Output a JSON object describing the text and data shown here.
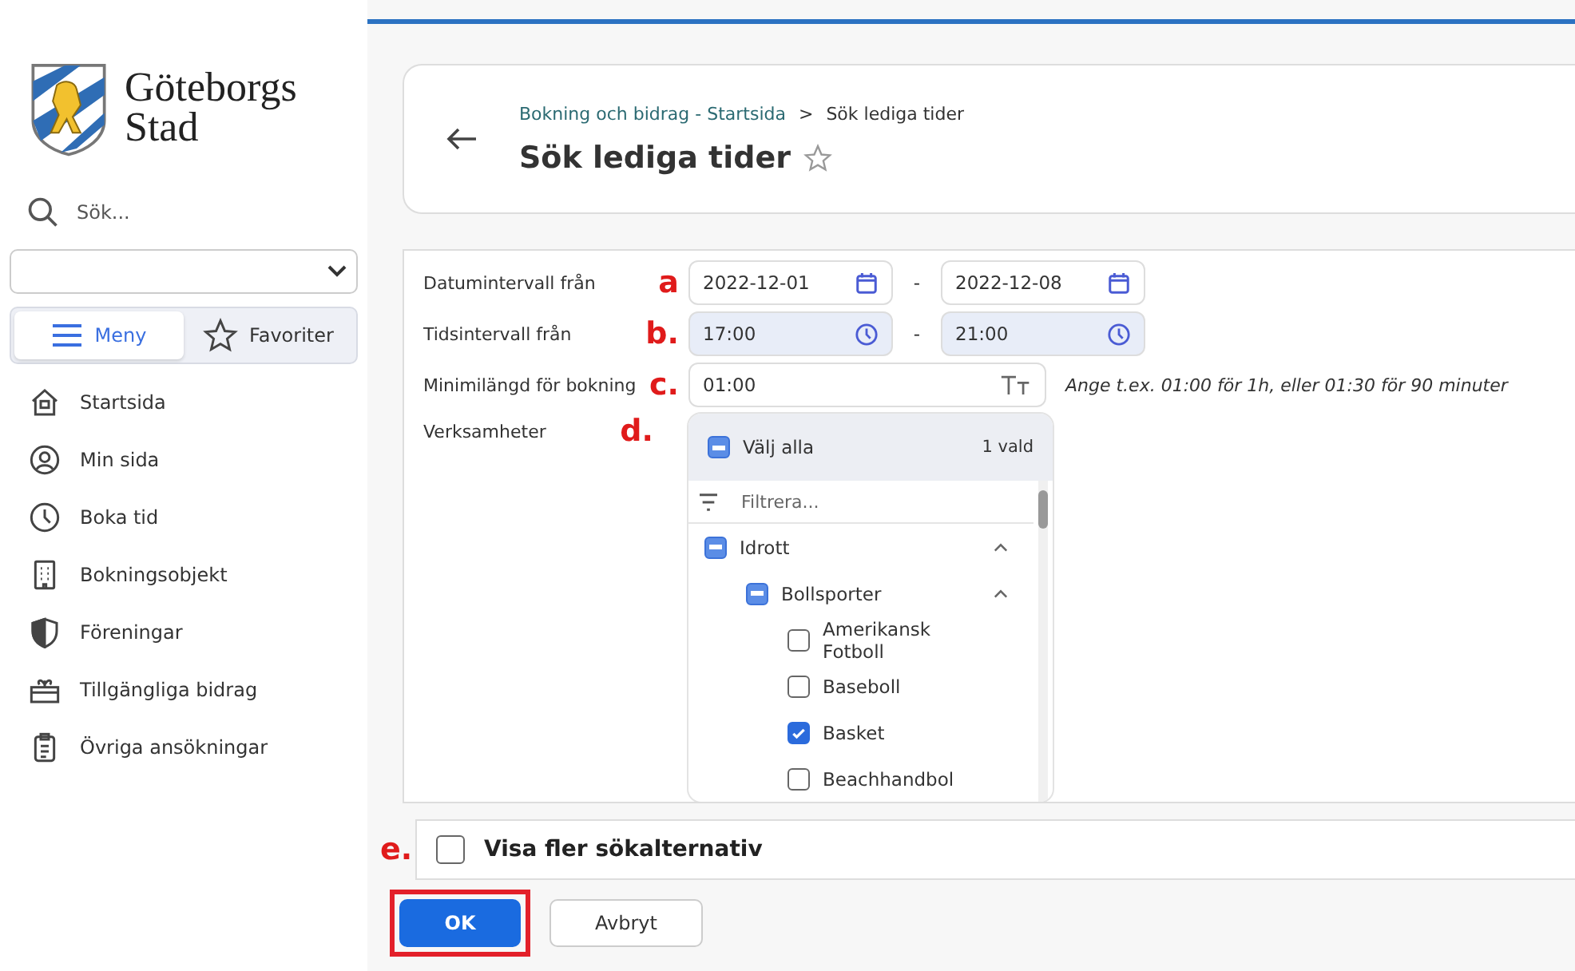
{
  "sidebar": {
    "logo_text": [
      "Göteborgs",
      "Stad"
    ],
    "search": {
      "placeholder": "Sök..."
    },
    "view_tabs": [
      {
        "label": "Meny",
        "selected": true,
        "kind": "menu"
      },
      {
        "label": "Favoriter",
        "selected": false,
        "kind": "star"
      }
    ],
    "items": [
      {
        "label": "Startsida",
        "kind": "home"
      },
      {
        "label": "Min sida",
        "kind": "user"
      },
      {
        "label": "Boka tid",
        "kind": "clock"
      },
      {
        "label": "Bokningsobjekt",
        "kind": "building"
      },
      {
        "label": "Föreningar",
        "kind": "shield"
      },
      {
        "label": "Tillgängliga bidrag",
        "kind": "gift"
      },
      {
        "label": "Övriga ansökningar",
        "kind": "clipboard"
      }
    ]
  },
  "header": {
    "breadcrumbs": [
      "Bokning och bidrag - Startsida",
      "Sök lediga tider"
    ],
    "separator": ">",
    "title": "Sök lediga tider",
    "favorite": false
  },
  "form": {
    "rows": [
      {
        "label": "Datumintervall från",
        "annotation": "a",
        "kind": "date",
        "from": "2022-12-01",
        "dash": "-",
        "to": "2022-12-08"
      },
      {
        "label": "Tidsintervall från",
        "annotation": "b.",
        "kind": "time",
        "from": "17:00",
        "dash": "-",
        "to": "21:00"
      },
      {
        "label": "Minimilängd för bokning",
        "annotation": "c.",
        "kind": "duration",
        "value": "01:00",
        "hint": "Ange t.ex. 01:00 för 1h, eller 01:30 för 90 minuter"
      },
      {
        "label": "Verksamheter",
        "annotation": "d.",
        "kind": "tree"
      }
    ],
    "tree": {
      "select_all": {
        "label": "Välj alla",
        "partial": true
      },
      "count": "1 vald",
      "filter_placeholder": "Filtrera...",
      "items": [
        {
          "label": "Idrott",
          "partial": true,
          "expanded": true,
          "children": [
            {
              "label": "Bollsporter",
              "partial": true,
              "expanded": true,
              "children": [
                {
                  "label": "Amerikansk Fotboll",
                  "checked": false
                },
                {
                  "label": "Baseboll",
                  "checked": false
                },
                {
                  "label": "Basket",
                  "checked": true
                },
                {
                  "label": "Beachhandbol",
                  "checked": false
                }
              ]
            }
          ]
        }
      ]
    }
  },
  "more_options": {
    "annotation": "e.",
    "label": "Visa fler sökalternativ",
    "checked": false
  },
  "buttons": [
    {
      "label": "OK",
      "kind": "primary",
      "highlighted": true
    },
    {
      "label": "Avbryt",
      "kind": "secondary",
      "highlighted": false
    }
  ]
}
